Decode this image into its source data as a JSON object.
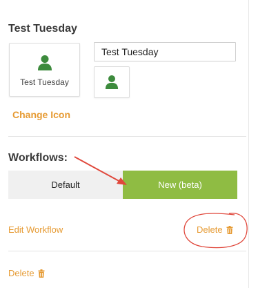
{
  "profile": {
    "title": "Test Tuesday",
    "card_label": "Test Tuesday",
    "name_input_value": "Test Tuesday",
    "change_icon_label": "Change Icon"
  },
  "workflows": {
    "label": "Workflows:",
    "options": [
      "Default",
      "New (beta)"
    ],
    "selected": "New (beta)",
    "edit_label": "Edit Workflow",
    "delete_label": "Delete"
  },
  "footer": {
    "delete_label": "Delete"
  },
  "colors": {
    "accent_orange": "#e69a32",
    "selected_green": "#8fbc43",
    "icon_green": "#3d8b3d",
    "annotation_red": "#e0483c"
  },
  "icons": {
    "user": "user-icon",
    "trash": "trash-icon"
  }
}
